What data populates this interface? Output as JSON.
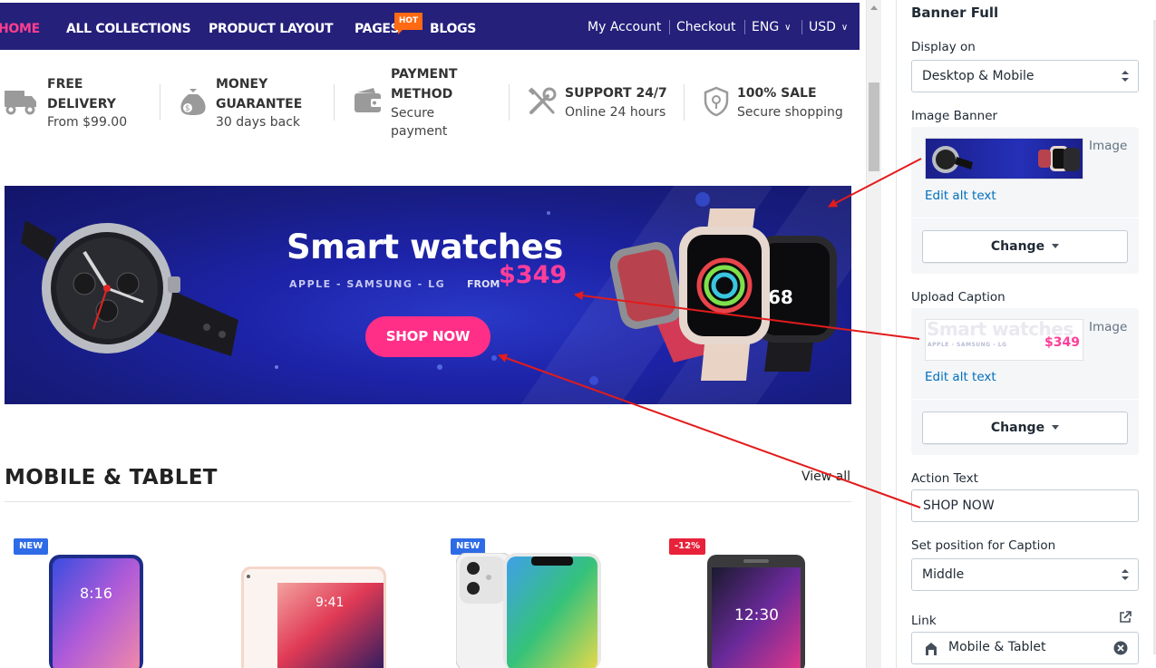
{
  "nav": {
    "items": [
      "HOME",
      "ALL COLLECTIONS",
      "PRODUCT LAYOUT",
      "PAGES",
      "BLOGS"
    ],
    "hot_badge": "HOT",
    "account": "My Account",
    "checkout": "Checkout",
    "language": "ENG",
    "currency": "USD",
    "active_color": "#ff3e8e",
    "bar_color": "#25207a"
  },
  "features": [
    {
      "icon": "truck-icon",
      "title_lines": [
        "FREE",
        "DELIVERY"
      ],
      "subtitle_lines": [
        "From $99.00"
      ]
    },
    {
      "icon": "money-bag-icon",
      "title_lines": [
        "MONEY",
        "GUARANTEE"
      ],
      "subtitle_lines": [
        "30 days back"
      ]
    },
    {
      "icon": "wallet-icon",
      "title_lines": [
        "PAYMENT",
        "METHOD"
      ],
      "subtitle_lines": [
        "Secure",
        "payment"
      ]
    },
    {
      "icon": "tools-icon",
      "title_lines": [
        "SUPPORT 24/7"
      ],
      "subtitle_lines": [
        "Online 24 hours"
      ]
    },
    {
      "icon": "shield-icon",
      "title_lines": [
        "100% SALE"
      ],
      "subtitle_lines": [
        "Secure shopping"
      ]
    }
  ],
  "banner": {
    "title": "Smart watches",
    "brands": "APPLE - SAMSUNG - LG",
    "from_label": "FROM",
    "price": "$349",
    "button": "SHOP NOW",
    "price_color": "#ff3e9a",
    "button_color": "#ff2f88"
  },
  "section": {
    "title": "MOBILE & TABLET",
    "view_all": "View all"
  },
  "products": [
    {
      "image": "phone-xiaomi-image",
      "badge": "NEW",
      "badge_type": "new",
      "screen_time": "8:16"
    },
    {
      "image": "ipad-image",
      "badge": "",
      "badge_type": "",
      "screen_time": "9:41"
    },
    {
      "image": "iphone-11-image",
      "badge": "NEW",
      "badge_type": "new",
      "screen_time": ""
    },
    {
      "image": "phone-lg-image",
      "badge": "-12%",
      "badge_type": "sale",
      "screen_time": "12:30"
    }
  ],
  "panel": {
    "title": "Banner Full",
    "display_on_label": "Display on",
    "display_on_value": "Desktop & Mobile",
    "image_banner_label": "Image Banner",
    "image_type_label": "Image",
    "edit_alt_text": "Edit alt text",
    "change_button": "Change",
    "upload_caption_label": "Upload Caption",
    "caption_thumb_title": "Smart watches",
    "caption_thumb_brands": "APPLE - SAMSUNG - LG",
    "caption_thumb_price": "$349",
    "action_text_label": "Action Text",
    "action_text_value": "SHOP NOW",
    "position_label": "Set position for Caption",
    "position_value": "Middle",
    "link_label": "Link",
    "link_value": "Mobile & Tablet"
  },
  "annotation_arrow_color": "#e31b1b"
}
